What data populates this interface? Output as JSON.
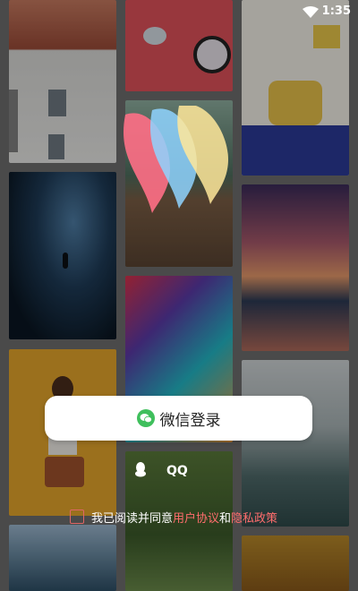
{
  "status_bar": {
    "time": "1:35",
    "wifi_icon": "wifi-icon"
  },
  "login": {
    "wechat_label": "微信登录",
    "wechat_icon": "wechat-icon",
    "qq_label": "QQ",
    "qq_icon": "qq-penguin-icon"
  },
  "agreement": {
    "prefix": "我已阅读并同意",
    "user_agreement": "用户协议",
    "conjunction": "和",
    "privacy_policy": "隐私政策"
  },
  "colors": {
    "wechat_green": "#3fbf5c",
    "link_red": "#ff6d6d",
    "logo_pink": "#ff6f86",
    "logo_blue": "#8fd3ff",
    "logo_yellow": "#ffe89a"
  }
}
